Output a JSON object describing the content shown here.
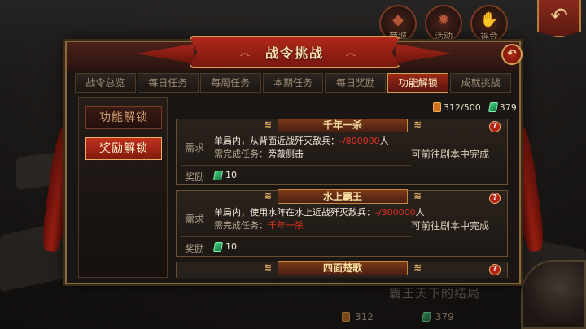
{
  "hud": {
    "top_icons": [
      {
        "label": "商城",
        "icon": "shop-icon"
      },
      {
        "label": "活动",
        "icon": "event-icon"
      },
      {
        "label": "福会",
        "icon": "welfare-icon"
      }
    ],
    "back_icon": "back-arrow-icon",
    "bottom_banner": "霸王天下的结局",
    "bottom_values": [
      "312",
      "379"
    ]
  },
  "panel": {
    "title": "战令挑战",
    "close_icon": "close-icon"
  },
  "tabs": [
    {
      "label": "战令总览",
      "active": false
    },
    {
      "label": "每日任务",
      "active": false
    },
    {
      "label": "每周任务",
      "active": false
    },
    {
      "label": "本期任务",
      "active": false
    },
    {
      "label": "每日奖励",
      "active": false
    },
    {
      "label": "功能解锁",
      "active": true
    },
    {
      "label": "成就挑战",
      "active": false
    }
  ],
  "sidebar": {
    "items": [
      {
        "label": "功能解锁",
        "active": false
      },
      {
        "label": "奖励解锁",
        "active": true
      }
    ]
  },
  "resources": {
    "scroll": "312/500",
    "jade": "379"
  },
  "labels": {
    "requirement": "需求",
    "reward": "奖励",
    "prereq_prefix": "需完成任务："
  },
  "cards": [
    {
      "title": "千年一杀",
      "desc_prefix": "单局内，从背面近战歼灭敌兵：",
      "progress": "-/800000",
      "desc_suffix": "人",
      "prereq": "旁敲侧击",
      "prereq_done": true,
      "reward": "10",
      "status": "可前往剧本中完成"
    },
    {
      "title": "水上霸王",
      "desc_prefix": "单局内，使用水阵在水上近战歼灭敌兵：",
      "progress": "-/300000",
      "desc_suffix": "人",
      "prereq": "千年一杀",
      "prereq_done": false,
      "reward": "10",
      "status": "可前往剧本中完成"
    },
    {
      "title": "四面楚歌"
    }
  ],
  "colors": {
    "accent_red": "#c0301c",
    "gold_border": "#d4a052",
    "warning_red": "#e2321e"
  }
}
